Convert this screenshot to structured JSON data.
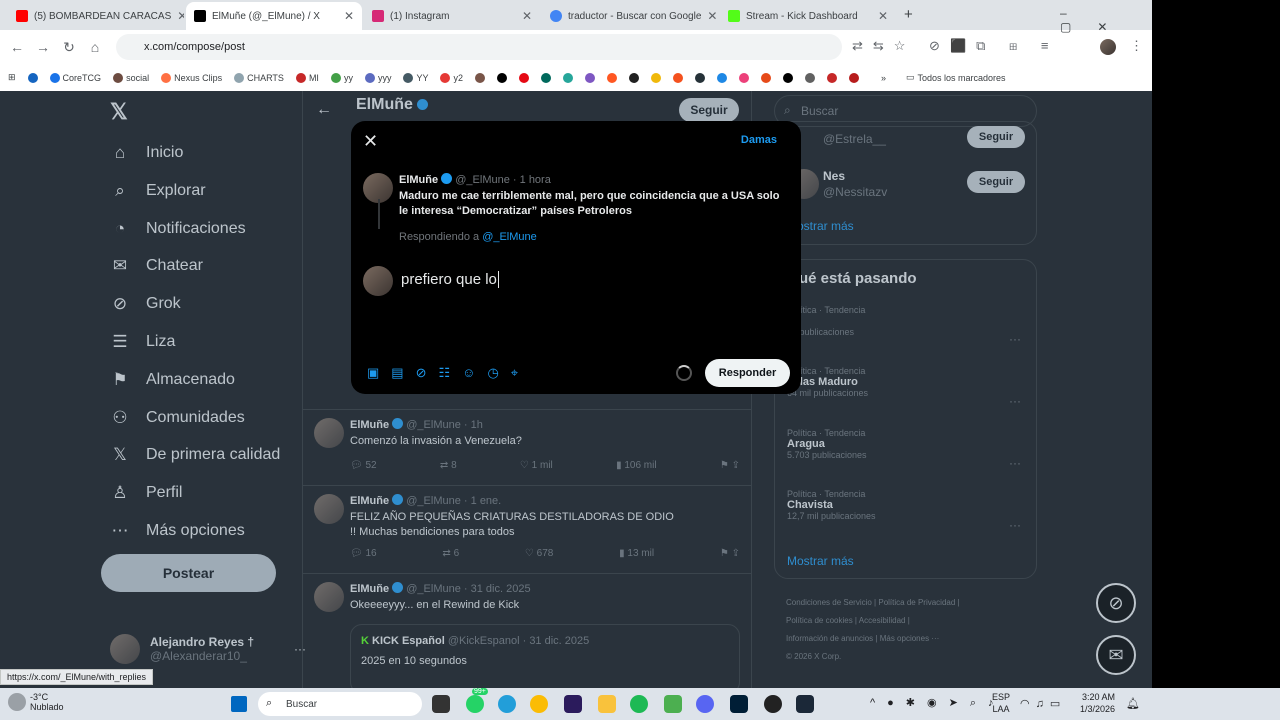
{
  "browser": {
    "tabs": [
      {
        "title": "(5) BOMBARDEAN CARACAS",
        "color": "#ff0000"
      },
      {
        "title": "ElMuñe (@_ElMune) / X",
        "color": "#000000"
      },
      {
        "title": "(1) Instagram",
        "color": "#d62976"
      },
      {
        "title": "traductor - Buscar con Google",
        "color": "#4285f4"
      },
      {
        "title": "Stream - Kick Dashboard",
        "color": "#53fc18"
      }
    ],
    "url": "x.com/compose/post",
    "bookmarks": [
      "CoreTCG",
      "social",
      "Nexus Clips",
      "CHARTS",
      "MI",
      "yy",
      "yyy",
      "YY",
      "y2"
    ],
    "bookmarks_all": "Todos los marcadores"
  },
  "sidebar": {
    "items": [
      {
        "label": "Inicio",
        "icon": "home-icon",
        "glyph": "⌂"
      },
      {
        "label": "Explorar",
        "icon": "search-icon",
        "glyph": "⌕"
      },
      {
        "label": "Notificaciones",
        "icon": "bell-icon",
        "glyph": "🔔"
      },
      {
        "label": "Chatear",
        "icon": "mail-icon",
        "glyph": "✉"
      },
      {
        "label": "Grok",
        "icon": "grok-icon",
        "glyph": "⊘"
      },
      {
        "label": "Liza",
        "icon": "list-icon",
        "glyph": "☰"
      },
      {
        "label": "Almacenado",
        "icon": "bookmark-icon",
        "glyph": "⚑"
      },
      {
        "label": "Comunidades",
        "icon": "communities-icon",
        "glyph": "⚇"
      },
      {
        "label": "De primera calidad",
        "icon": "x-premium-icon",
        "glyph": "𝕏"
      },
      {
        "label": "Perfil",
        "icon": "person-icon",
        "glyph": "♙"
      },
      {
        "label": "Más opciones",
        "icon": "more-circle-icon",
        "glyph": "⋯"
      }
    ],
    "post_button": "Postear",
    "user": {
      "name": "Alejandro Reyes †",
      "handle": "@Alexanderar10_"
    }
  },
  "profile": {
    "name": "ElMuñe",
    "follow": "Seguir"
  },
  "tweets": [
    {
      "name": "ElMuñe",
      "handle": "@_ElMune",
      "time": "1h",
      "text": "Comenzó la invasión a Venezuela?",
      "replies": "52",
      "reposts": "8",
      "likes": "1 mil",
      "views": "106 mil"
    },
    {
      "name": "ElMuñe",
      "handle": "@_ElMune",
      "time": "1 ene.",
      "text": "FELIZ AÑO PEQUEÑAS CRIATURAS DESTILADORAS DE ODIO !! Muchas bendiciones para todos",
      "replies": "16",
      "reposts": "6",
      "likes": "678",
      "views": "13 mil"
    },
    {
      "name": "ElMuñe",
      "handle": "@_ElMune",
      "time": "31 dic. 2025",
      "text": "Okeeeeyyy... en el Rewind de Kick",
      "quote": {
        "name": "KICK Español",
        "handle": "@KickEspanol",
        "time": "31 dic. 2025",
        "text": "2025 en 10 segundos"
      }
    }
  ],
  "right": {
    "search_placeholder": "Buscar",
    "follow_suggestions": [
      {
        "name": "",
        "handle": "@Estrela__",
        "button": "Seguir"
      },
      {
        "name": "Nes",
        "handle": "@Nessitazv",
        "button": "Seguir"
      }
    ],
    "show_more": "Mostrar más",
    "trends_title": "ué está pasando",
    "trends": [
      {
        "cat": "Política · Tendencia",
        "name": "r",
        "count": "73 publicaciones"
      },
      {
        "cat": "Política · Tendencia",
        "name": "colas Maduro",
        "count": "64 mil publicaciones"
      },
      {
        "cat": "Política · Tendencia",
        "name": "Aragua",
        "count": "5.703 publicaciones"
      },
      {
        "cat": "Política · Tendencia",
        "name": "Chavista",
        "count": "12,7 mil publicaciones"
      }
    ],
    "footer": [
      "Condiciones de Servicio",
      "Política de Privacidad",
      "Política de cookies",
      "Accesibilidad",
      "Información de anuncios",
      "Más opciones ···",
      "© 2026 X Corp."
    ]
  },
  "modal": {
    "drafts": "Damas",
    "quoted": {
      "name": "ElMuñe",
      "handle": "@_ElMune",
      "time": "1 hora",
      "text": "Maduro me cae terriblemente mal, pero que coincidencia que a USA solo le interesa “Democratizar” países Petroleros"
    },
    "replying_prefix": "Respondiendo a",
    "replying_handle": "@_ElMune",
    "draft_text": "prefiero que lo",
    "reply_button": "Responder"
  },
  "status_url": "https://x.com/_ElMune/with_replies",
  "taskbar": {
    "weather_temp": "-3°C",
    "weather_desc": "Nublado",
    "search": "Buscar",
    "badge": "99+",
    "lang": "ESP",
    "lang2": "LAA",
    "time": "3:20 AM",
    "date": "1/3/2026"
  }
}
